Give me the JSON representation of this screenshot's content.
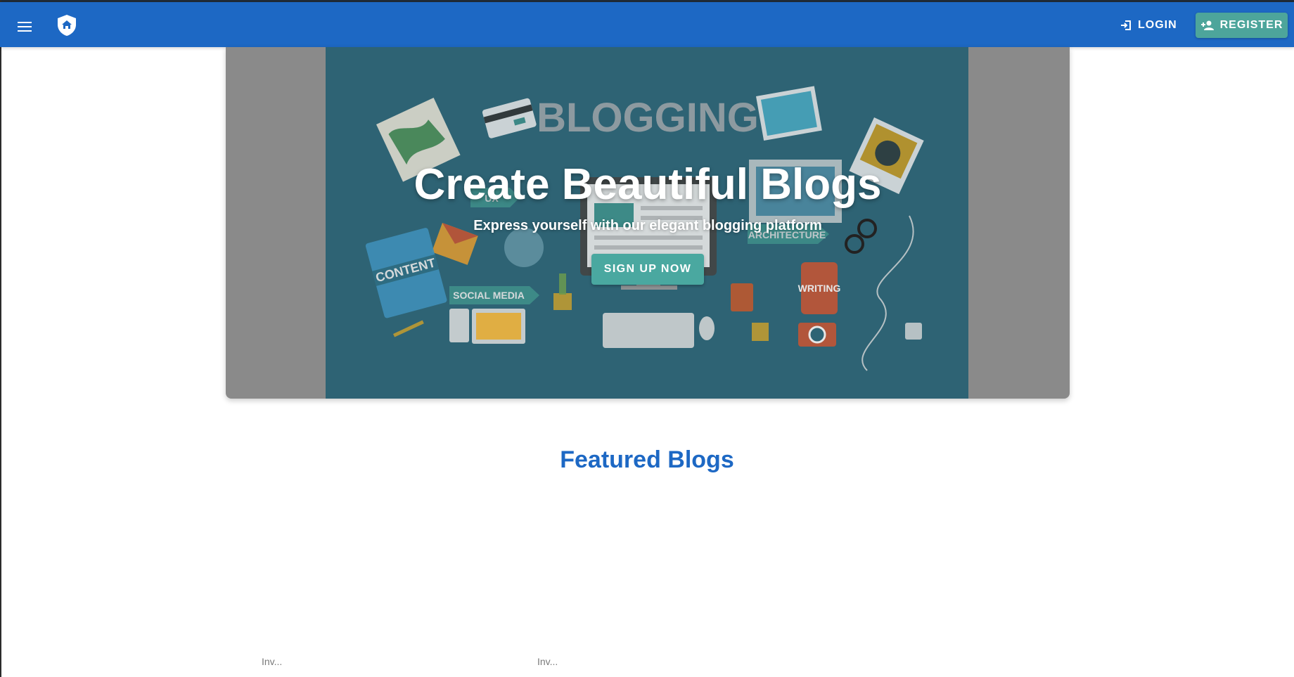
{
  "header": {
    "menu_icon": "menu-icon",
    "logo_icon": "shield-home-icon",
    "login_label": "LOGIN",
    "login_icon": "login-icon",
    "register_label": "REGISTER",
    "register_icon": "person-add-icon"
  },
  "hero": {
    "title": "Create Beautiful Blogs",
    "subtitle": "Express yourself with our elegant blogging platform",
    "cta_label": "SIGN UP NOW",
    "art_words": {
      "blogging": "BLOGGING",
      "content": "CONTENT",
      "social_media": "SOCIAL MEDIA",
      "writing": "WRITING",
      "architecture": "ARCHITECTURE",
      "ux": "UX"
    }
  },
  "featured": {
    "title": "Featured Blogs",
    "cards": [
      {
        "snippet": "Inv..."
      },
      {
        "snippet": "Inv..."
      }
    ]
  },
  "colors": {
    "appbar": "#1d68c4",
    "accent": "#4aa8a0",
    "hero_bg": "#2e6374",
    "side_gray": "#8a8a8a"
  }
}
